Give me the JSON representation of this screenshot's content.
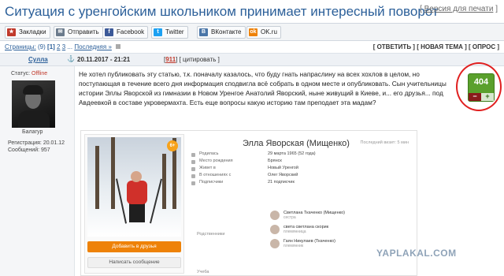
{
  "page": {
    "title": "Ситуация с уренгойским школьником принимает интересный поворот",
    "print_link": "Версия для печати"
  },
  "share": {
    "buttons": [
      {
        "label": "Закладки",
        "icon": "bookmark-icon",
        "color": "#c0392b",
        "glyph": "★"
      },
      {
        "label": "Отправить",
        "icon": "mail-icon",
        "color": "#6b7b8c",
        "glyph": "✉"
      },
      {
        "label": "Facebook",
        "icon": "facebook-icon",
        "color": "#3b5998",
        "glyph": "f"
      },
      {
        "label": "Twitter",
        "icon": "twitter-icon",
        "color": "#1da1f2",
        "glyph": "t"
      },
      {
        "label": "ВКонтакте",
        "icon": "vk-icon",
        "color": "#4a76a8",
        "glyph": "B"
      },
      {
        "label": "OK.ru",
        "icon": "odnoklassniki-icon",
        "color": "#ee8208",
        "glyph": "ok"
      }
    ]
  },
  "pager": {
    "label": "Страницы:",
    "count": "(9)",
    "current": "[1]",
    "p2": "2",
    "p3": "3",
    "ellipsis": "...",
    "last": "Последняя »"
  },
  "actions": {
    "reply": "[ ОТВЕТИТЬ ]",
    "new_topic": "[ НОВАЯ ТЕМА ]",
    "poll": "[ ОПРОС ]"
  },
  "post": {
    "author": "Сулла",
    "date": "20.11.2017 - 21:21",
    "number_prefix": "[",
    "number": "911",
    "number_suffix": "]",
    "quote": "[ цитировать ]",
    "text": "Не хотел публиковать эту статью, т.к. поначалу казалось, что буду гнать напраслину на всех хохлов в целом, но поступающая в течение всего дня информация сподвигла всё собрать в одном месте и опубликовать. Сын учительницы истории Эллы Яворской из гимназии в Новом Уренгое Анатолий Яворский, ныне живущий в Киеве, и... его друзья... под Авдеевкой в составе укровермахта. Есть еще вопросы какую историю там преподает эта мадам?",
    "rating": "404",
    "rating_minus": "−",
    "rating_plus": "+"
  },
  "user": {
    "status_label": "Статус:",
    "status_value": "Offline",
    "rank": "Балагур",
    "reg_label": "Регистрация:",
    "reg_value": "20.01.12",
    "msgs_label": "Сообщений:",
    "msgs_value": "957"
  },
  "profile": {
    "name": "Элла Яворская (Мищенко)",
    "last_visit": "Последний визит: 5 мин",
    "age_badge": "6+",
    "add_friend": "Добавить в друзья",
    "write_message": "Написать сообщение",
    "info": [
      {
        "k": "Родилась",
        "v": "29 марта 1965 (52 года)"
      },
      {
        "k": "Место рождения",
        "v": "Брянск"
      },
      {
        "k": "Живет в",
        "v": "Новый Уренгой"
      },
      {
        "k": "В отношениях с",
        "v": "Олег Яворский"
      },
      {
        "k": "Подписчики",
        "v": "21 подписчик"
      }
    ],
    "relatives_label": "Родственники",
    "relatives": [
      {
        "n": "Светлана Ткаченко (Мищенко)",
        "r": "сестра"
      },
      {
        "n": "света светлана скорик",
        "r": "племянница"
      },
      {
        "n": "Гаян Никулаев (Ткаченко)",
        "r": "племянник"
      }
    ],
    "study_label": "Учеба"
  },
  "watermark": "YAPLAKAL.COM"
}
